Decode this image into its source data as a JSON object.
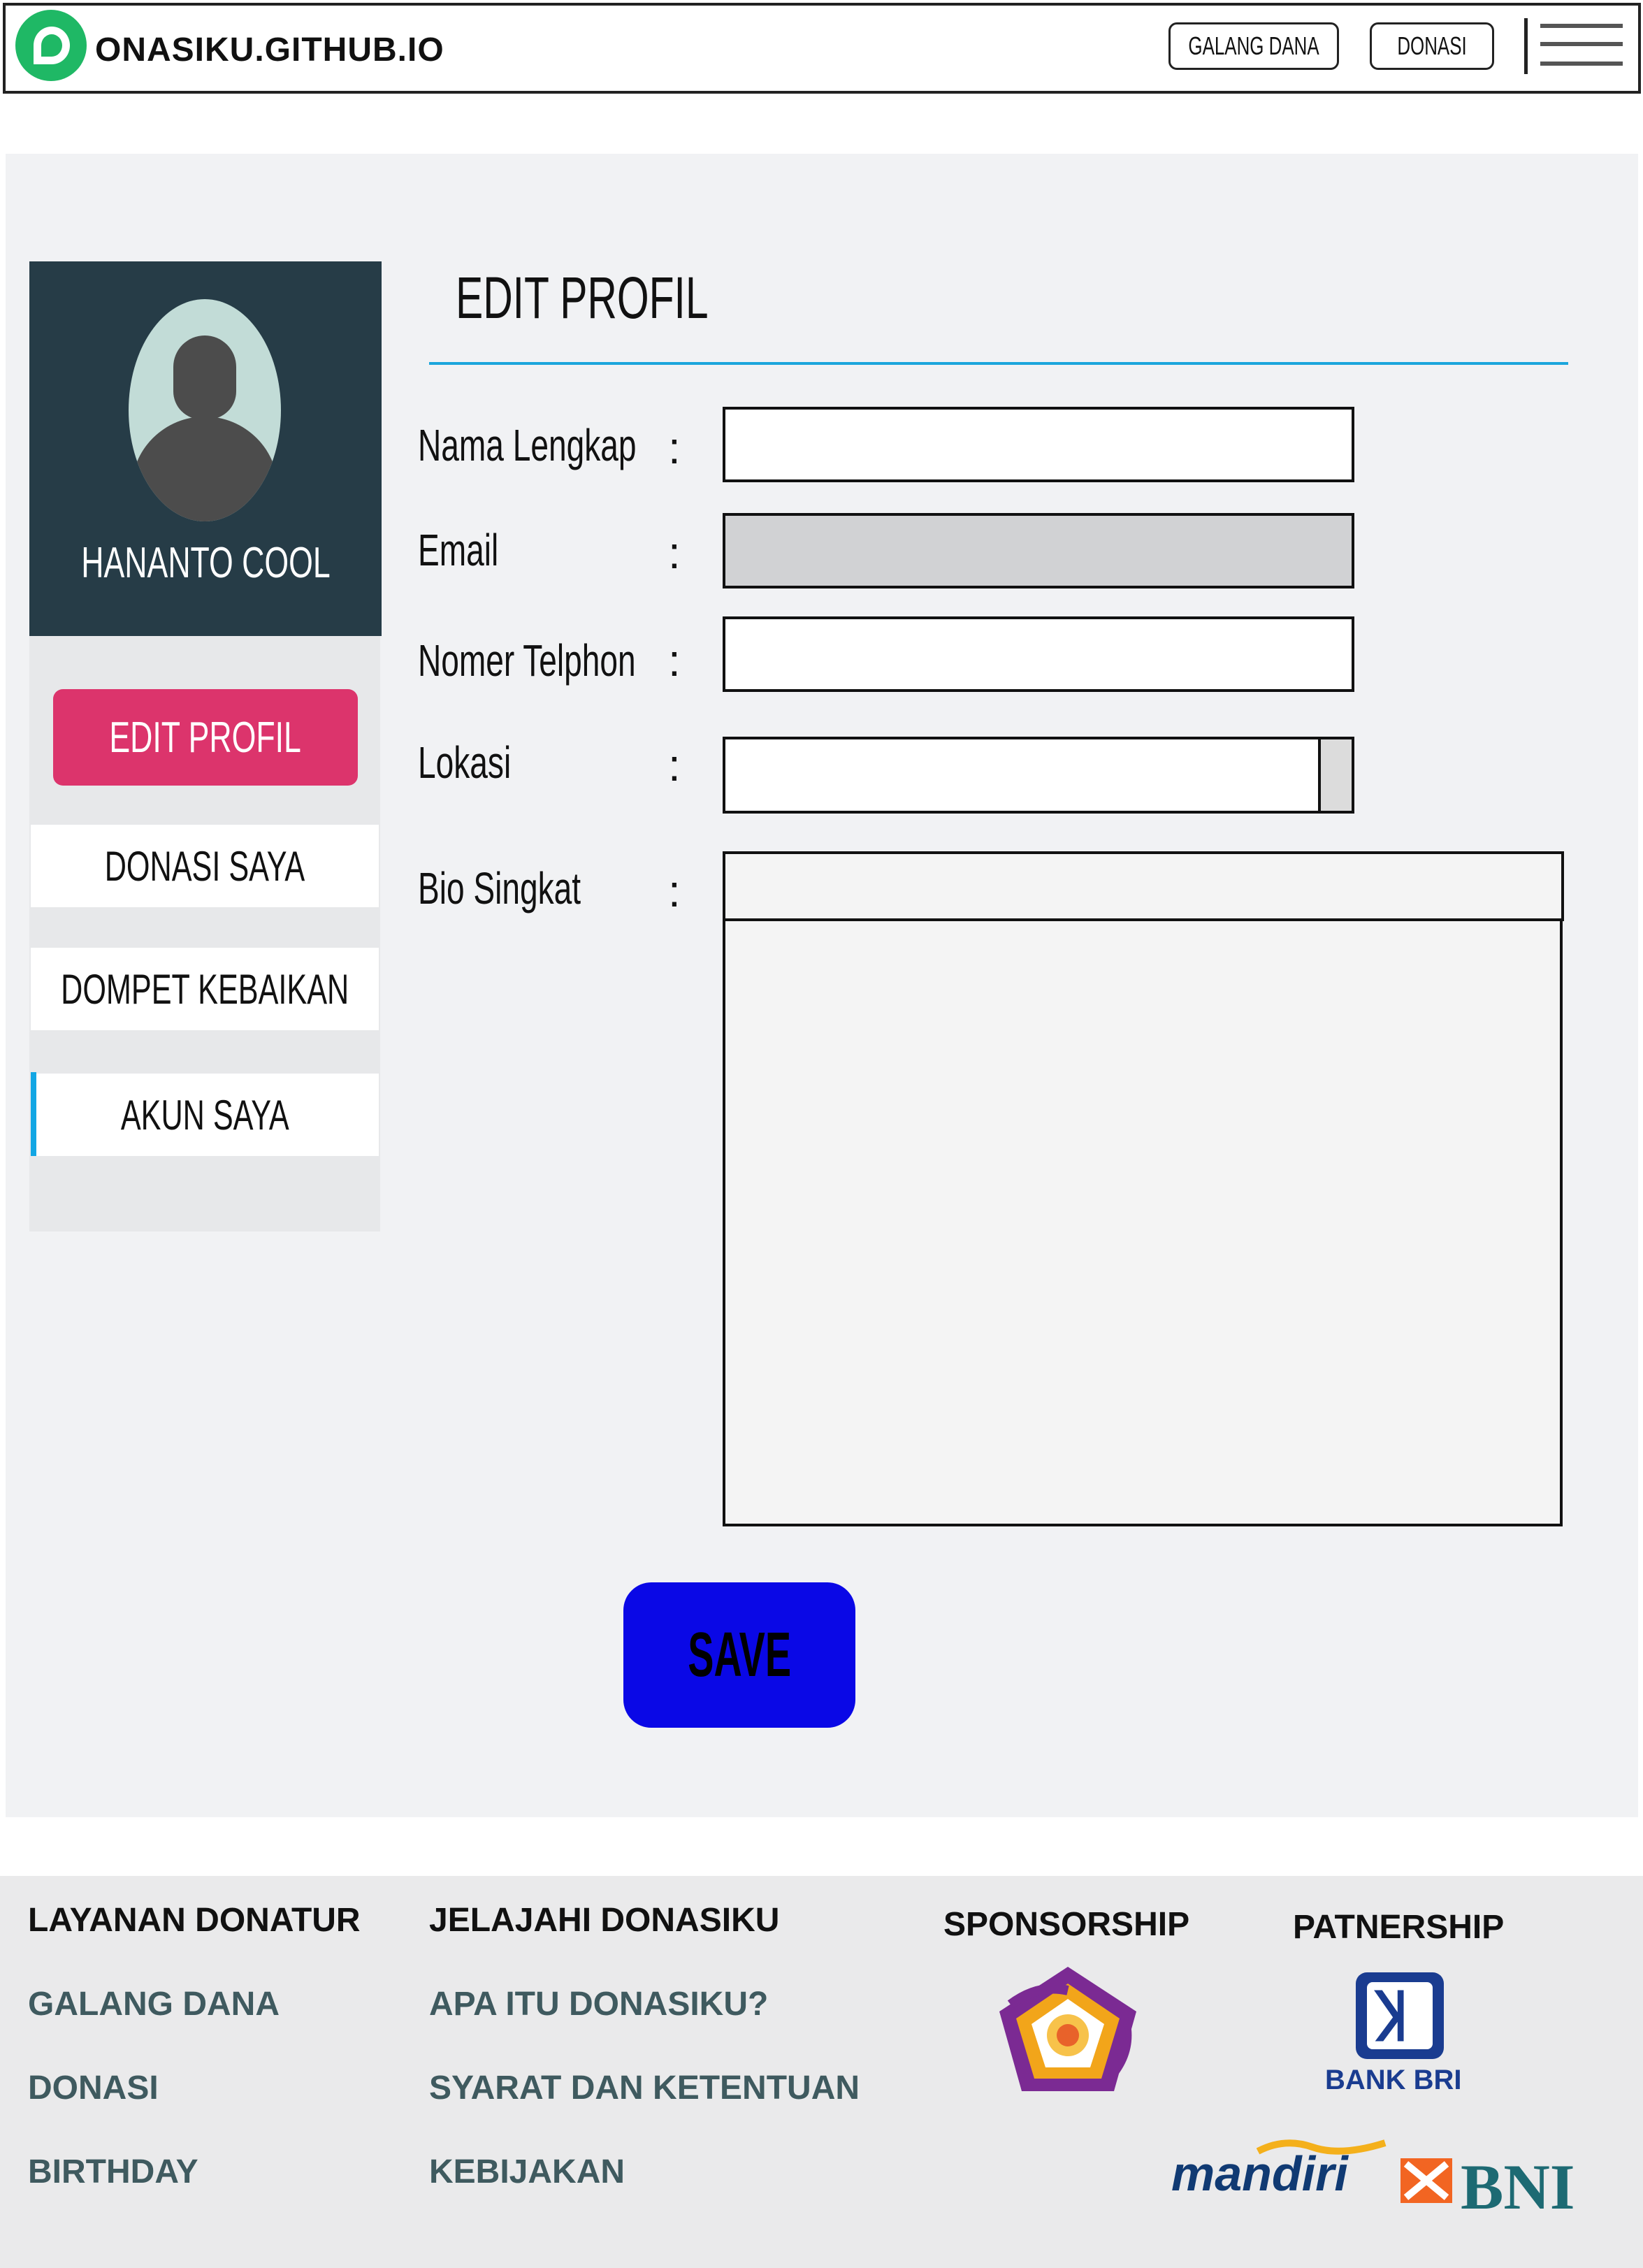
{
  "header": {
    "brand_text": "ONASIKU.GITHUB.IO",
    "nav": {
      "galang_dana": "GALANG DANA",
      "donasi": "DONASI"
    },
    "icons": {
      "logo": "donasiku-logo-icon",
      "menu": "hamburger-menu-icon"
    }
  },
  "sidebar": {
    "user_name": "HANANTO COOL",
    "active_button": "EDIT PROFIL",
    "items": [
      {
        "label": "DONASI SAYA"
      },
      {
        "label": "DOMPET KEBAIKAN"
      },
      {
        "label": "AKUN SAYA"
      }
    ],
    "colors": {
      "header_bg": "#263c47",
      "active_button_bg": "#dc346c",
      "active_indicator": "#12a6e4"
    }
  },
  "form": {
    "title": "EDIT PROFIL",
    "colon": ":",
    "fields": {
      "nama": {
        "label": "Nama Lengkap",
        "value": ""
      },
      "email": {
        "label": "Email",
        "value": ""
      },
      "telp": {
        "label": "Nomer Telphon",
        "value": ""
      },
      "lokasi": {
        "label": "Lokasi",
        "value": ""
      },
      "bio": {
        "label": "Bio Singkat",
        "value": ""
      }
    },
    "save_label": "SAVE",
    "colors": {
      "title_rule": "#1ba6dc",
      "save_bg": "#0a08e6",
      "disabled_input": "#d1d2d4"
    }
  },
  "footer": {
    "col1": {
      "heading": "LAYANAN DONATUR",
      "links": [
        "GALANG DANA",
        "DONASI",
        "BIRTHDAY"
      ]
    },
    "col2": {
      "heading": "JELAJAHI DONASIKU",
      "links": [
        "APA ITU DONASIKU?",
        "SYARAT DAN KETENTUAN",
        "KEBIJAKAN"
      ]
    },
    "sponsorship": {
      "heading": "SPONSORSHIP",
      "logo_icon": "sponsor-logo-icon"
    },
    "partnership": {
      "heading": "PATNERSHIP",
      "logos": {
        "bri": "BANK BRI",
        "mandiri": "mandiri",
        "bni": "BNI"
      }
    }
  }
}
